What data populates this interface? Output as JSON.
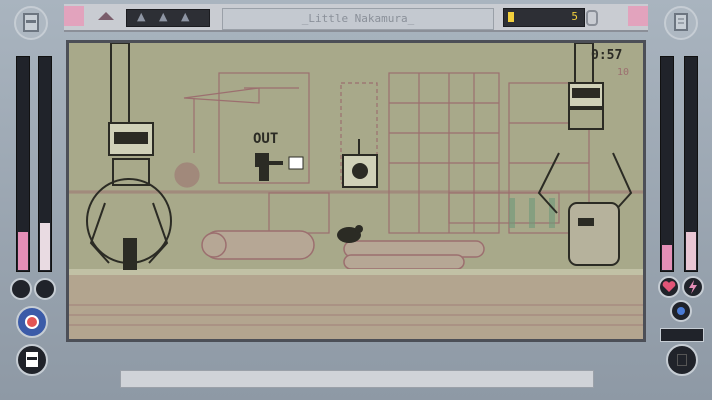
{
  "header": {
    "title": "_Little Nakamura_",
    "coin_count": "5",
    "level_markers": [
      "▲",
      "▲",
      "▲"
    ]
  },
  "hud": {
    "timer": "0:57",
    "score": "10",
    "out_text": "OUT"
  },
  "meters": {
    "left_a": 0.18,
    "left_b": 0.22,
    "right_a": 0.12,
    "right_b": 0.18
  },
  "colors": {
    "screen_bg": "#a8a98a",
    "dark": "#2b2b24",
    "bg_line": "#9c6f6f",
    "pink": "#e48fb7",
    "coin": "#f2cf3c"
  },
  "icons": {
    "left_top": "ninja-face-icon",
    "right_top": "document-icon",
    "heart": "heart-icon",
    "lightning": "lightning-icon",
    "target": "target-icon",
    "portrait": "ninja-portrait-icon",
    "right_bottom": "dark-orb-icon"
  }
}
